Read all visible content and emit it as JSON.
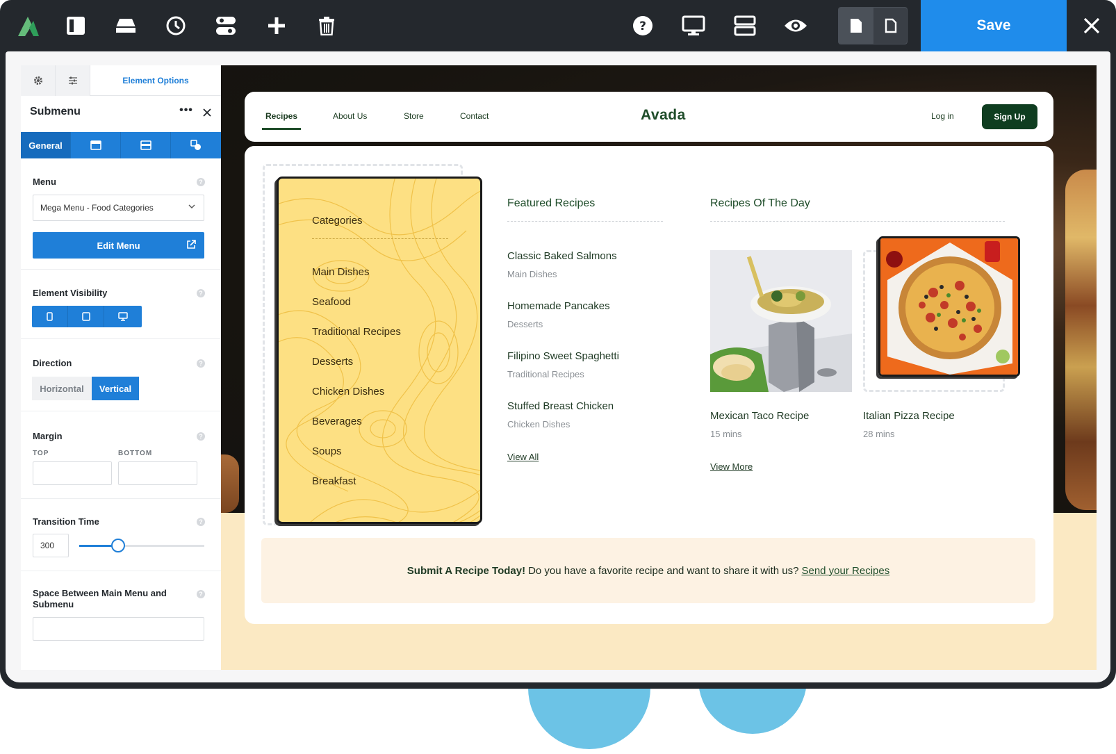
{
  "toolbar": {
    "brand_logo": "avada-logo-icon",
    "icons": [
      "sidebar-toggle-icon",
      "library-icon",
      "history-icon",
      "settings-toggle-icon",
      "add-icon",
      "trash-icon",
      "help-icon",
      "desktop-preview-icon",
      "layout-icon",
      "eye-icon",
      "page-icon",
      "page-outline-icon",
      "close-icon"
    ],
    "save_label": "Save"
  },
  "panel": {
    "tab_label": "Element Options",
    "title": "Submenu",
    "more": "•••",
    "subtabs": {
      "general": "General"
    },
    "menu": {
      "label": "Menu",
      "selected": "Mega Menu - Food Categories",
      "edit_button": "Edit Menu"
    },
    "visibility": {
      "label": "Element Visibility"
    },
    "direction": {
      "label": "Direction",
      "horizontal": "Horizontal",
      "vertical": "Vertical",
      "selected": "Vertical"
    },
    "margin": {
      "label": "Margin",
      "top": "TOP",
      "bottom": "BOTTOM",
      "top_value": "",
      "bottom_value": ""
    },
    "transition": {
      "label": "Transition Time",
      "value": "300",
      "fill_fraction": 0.31
    },
    "space": {
      "label": "Space Between Main Menu and Submenu",
      "value": ""
    }
  },
  "site": {
    "nav": [
      "Recipes",
      "About Us",
      "Store",
      "Contact"
    ],
    "brand": "Avada",
    "login": "Log in",
    "signup": "Sign Up"
  },
  "mega": {
    "categories_title": "Categories",
    "categories": [
      "Main Dishes",
      "Seafood",
      "Traditional Recipes",
      "Desserts",
      "Chicken Dishes",
      "Beverages",
      "Soups",
      "Breakfast"
    ],
    "featured_heading": "Featured Recipes",
    "featured": [
      {
        "title": "Classic Baked Salmons",
        "category": "Main Dishes"
      },
      {
        "title": "Homemade Pancakes",
        "category": "Desserts"
      },
      {
        "title": "Filipino Sweet Spaghetti",
        "category": "Traditional Recipes"
      },
      {
        "title": "Stuffed Breast Chicken",
        "category": "Chicken Dishes"
      }
    ],
    "view_all": "View All",
    "day_heading": "Recipes Of The Day",
    "day": [
      {
        "title": "Mexican Taco Recipe",
        "time": "15 mins"
      },
      {
        "title": "Italian Pizza Recipe",
        "time": "28 mins"
      }
    ],
    "view_more": "View More"
  },
  "banner": {
    "lead": "Submit A Recipe Today!",
    "text": "Do you have a favorite recipe and want to share it with us?",
    "link": "Send your Recipes"
  },
  "colors": {
    "toolbar_bg": "#24282d",
    "accent_blue": "#1f8ceb",
    "site_green": "#1f4d2a",
    "card_yellow": "#fde083"
  }
}
